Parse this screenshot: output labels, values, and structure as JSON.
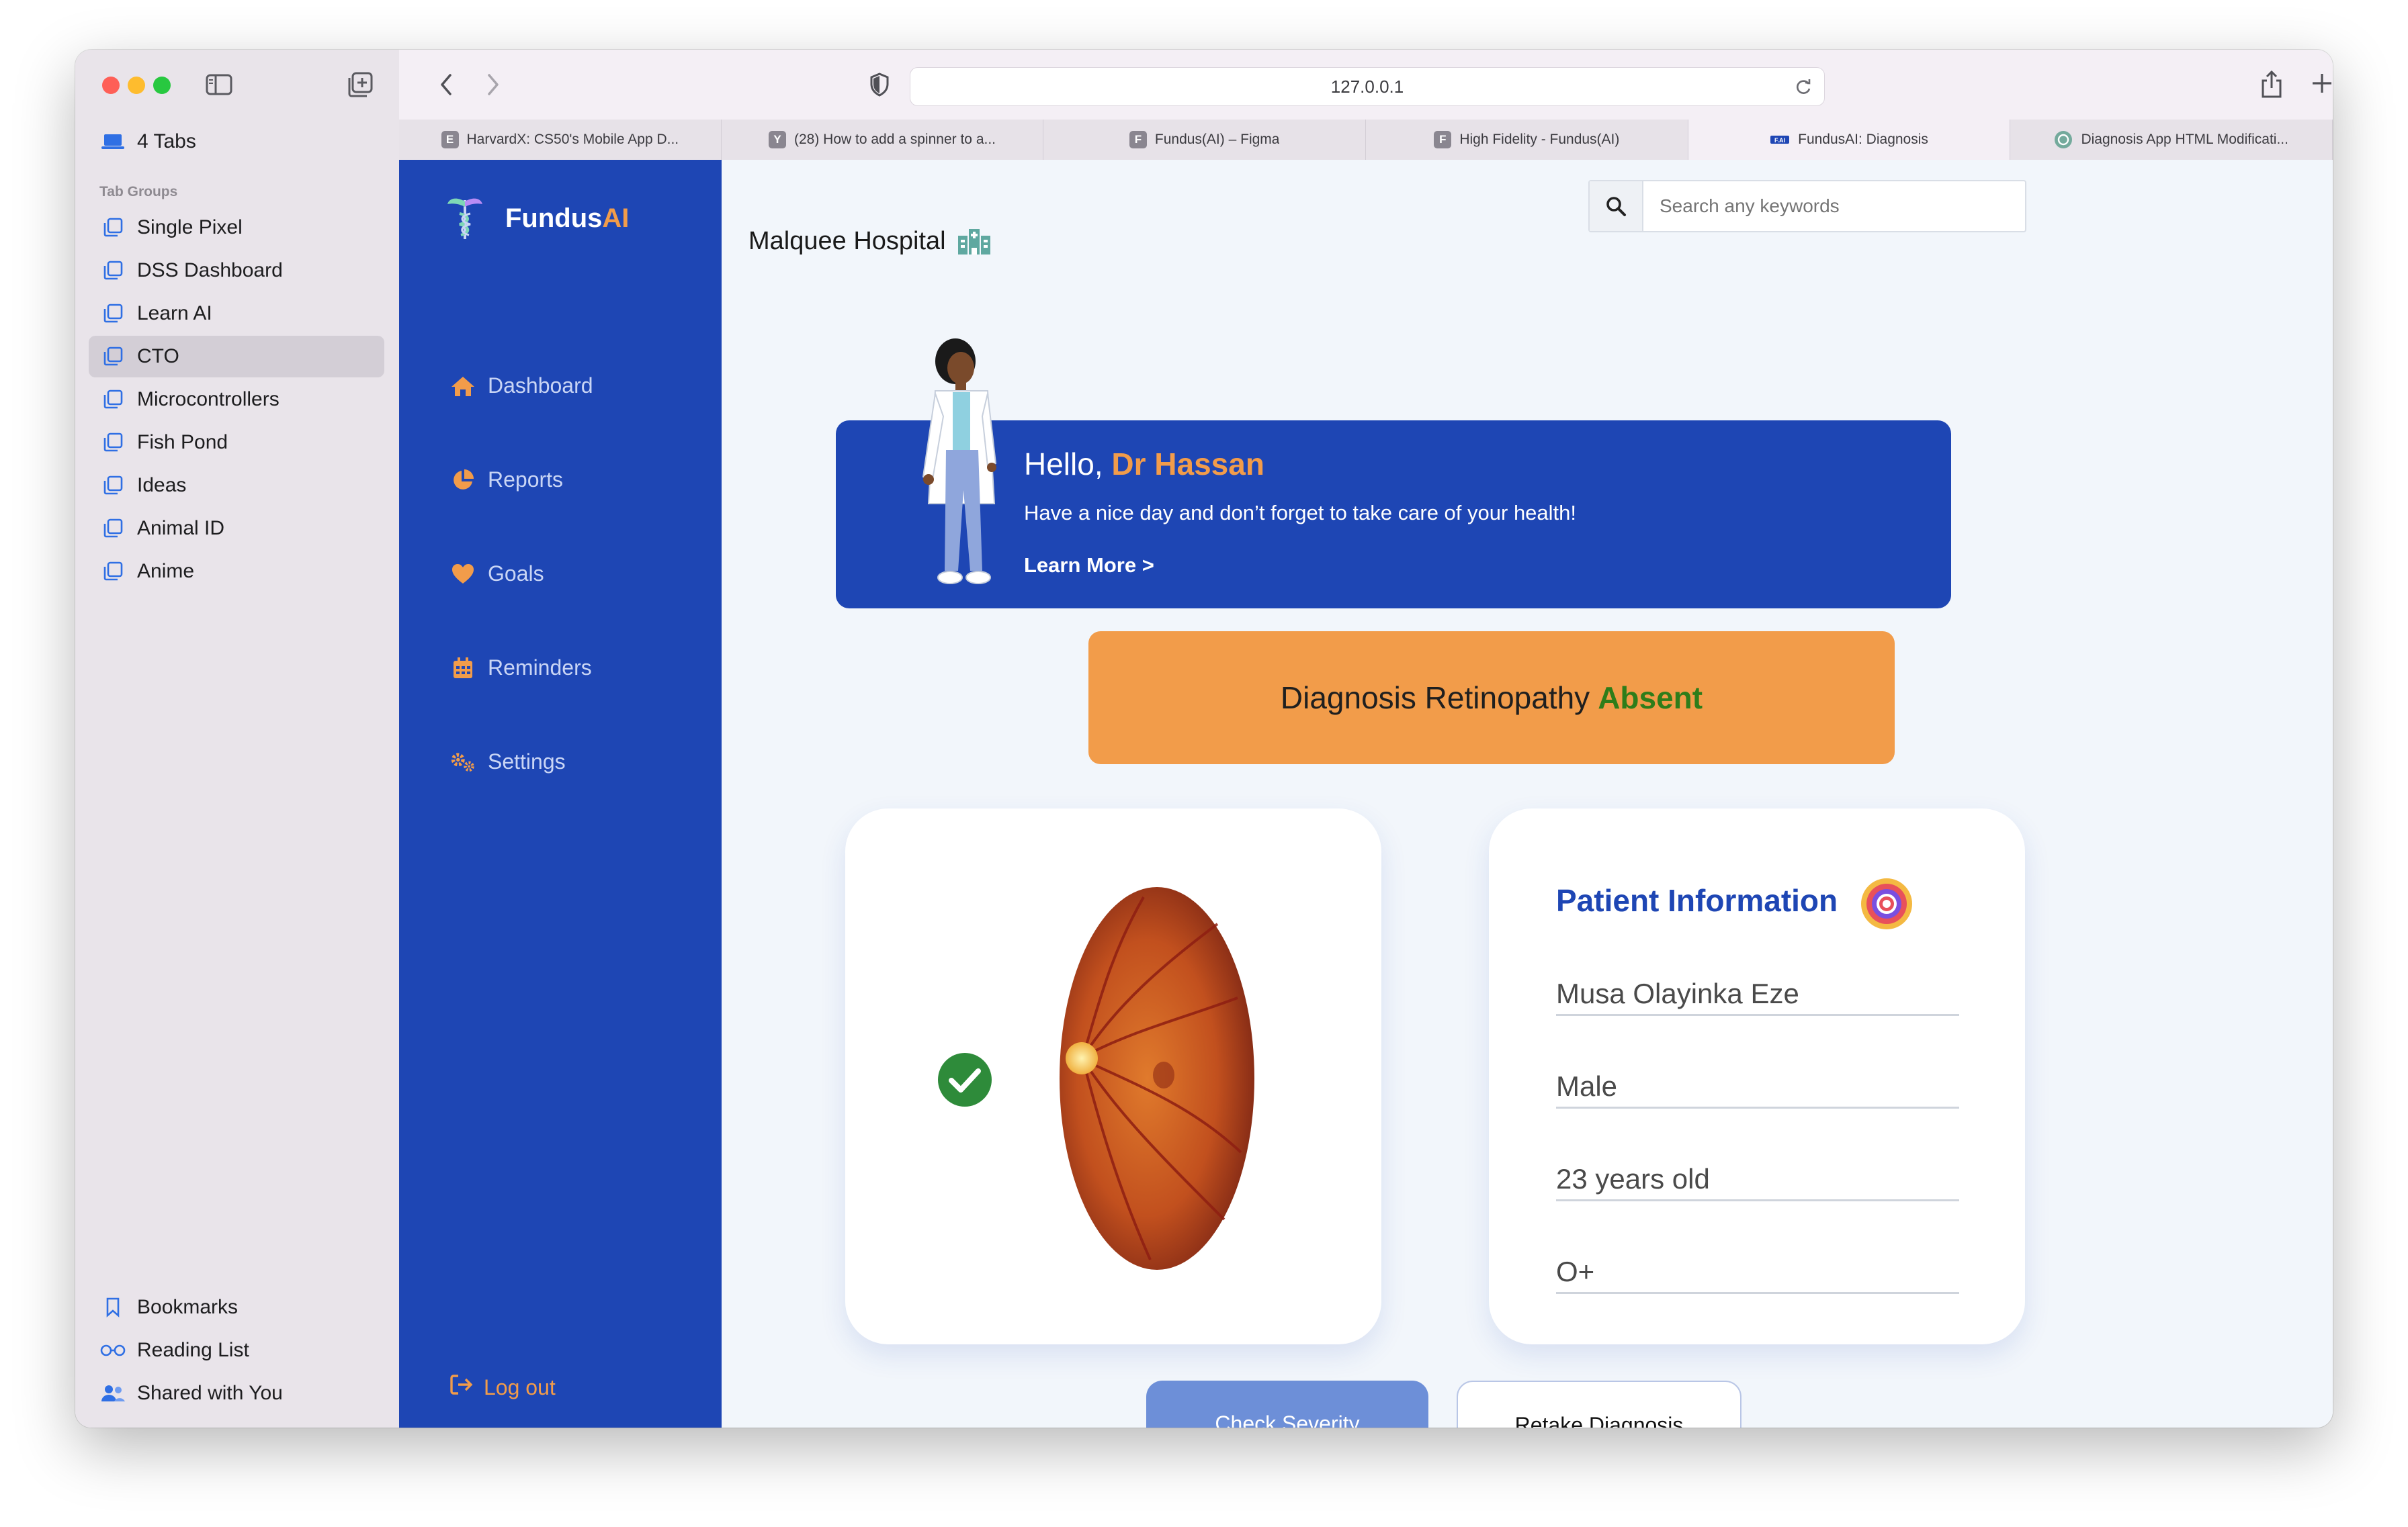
{
  "browser": {
    "url": "127.0.0.1",
    "tabs": [
      {
        "favicon": "E",
        "label": "HarvardX: CS50's Mobile App D..."
      },
      {
        "favicon": "Y",
        "label": "(28) How to add a spinner to a..."
      },
      {
        "favicon": "F",
        "label": "Fundus(AI) – Figma"
      },
      {
        "favicon": "F",
        "label": "High Fidelity - Fundus(AI)"
      },
      {
        "favicon": "fundusai-logo",
        "label": "FundusAI: Diagnosis",
        "active": true
      },
      {
        "favicon": "openai-logo",
        "label": "Diagnosis App HTML Modificati..."
      }
    ]
  },
  "safari_sidebar": {
    "tabs_count_label": "4 Tabs",
    "tab_groups_heading": "Tab Groups",
    "groups": [
      "Single Pixel",
      "DSS Dashboard",
      "Learn AI",
      "CTO",
      "Microcontrollers",
      "Fish Pond",
      "Ideas",
      "Animal ID",
      "Anime"
    ],
    "selected_group": "CTO",
    "footer": [
      "Bookmarks",
      "Reading List",
      "Shared with You"
    ]
  },
  "app": {
    "brand_main": "Fundus",
    "brand_accent": "AI",
    "nav": [
      {
        "label": "Dashboard",
        "icon": "home-icon"
      },
      {
        "label": "Reports",
        "icon": "pie-chart-icon"
      },
      {
        "label": "Goals",
        "icon": "heart-icon"
      },
      {
        "label": "Reminders",
        "icon": "calendar-icon"
      },
      {
        "label": "Settings",
        "icon": "gears-icon"
      }
    ],
    "logout": "Log out",
    "search_placeholder": "Search any keywords",
    "hospital": "Malquee Hospital",
    "greeting": "Hello,",
    "doctor": "Dr Hassan",
    "banner_message": "Have a nice day and don’t forget to take care of your health!",
    "learn_more": "Learn More >",
    "diagnosis_label": "Diagnosis Retinopathy",
    "diagnosis_status": "Absent",
    "patient_info_title": "Patient Information",
    "patient": {
      "name": "Musa Olayinka Eze",
      "gender": "Male",
      "age": "23 years old",
      "blood_group": "O+"
    },
    "buttons": {
      "check_severity": "Check Severity",
      "retake": "Retake Diagnosis"
    }
  },
  "colors": {
    "primary": "#1e46b4",
    "accent": "#f29c4a",
    "success": "#2e7d1a"
  }
}
